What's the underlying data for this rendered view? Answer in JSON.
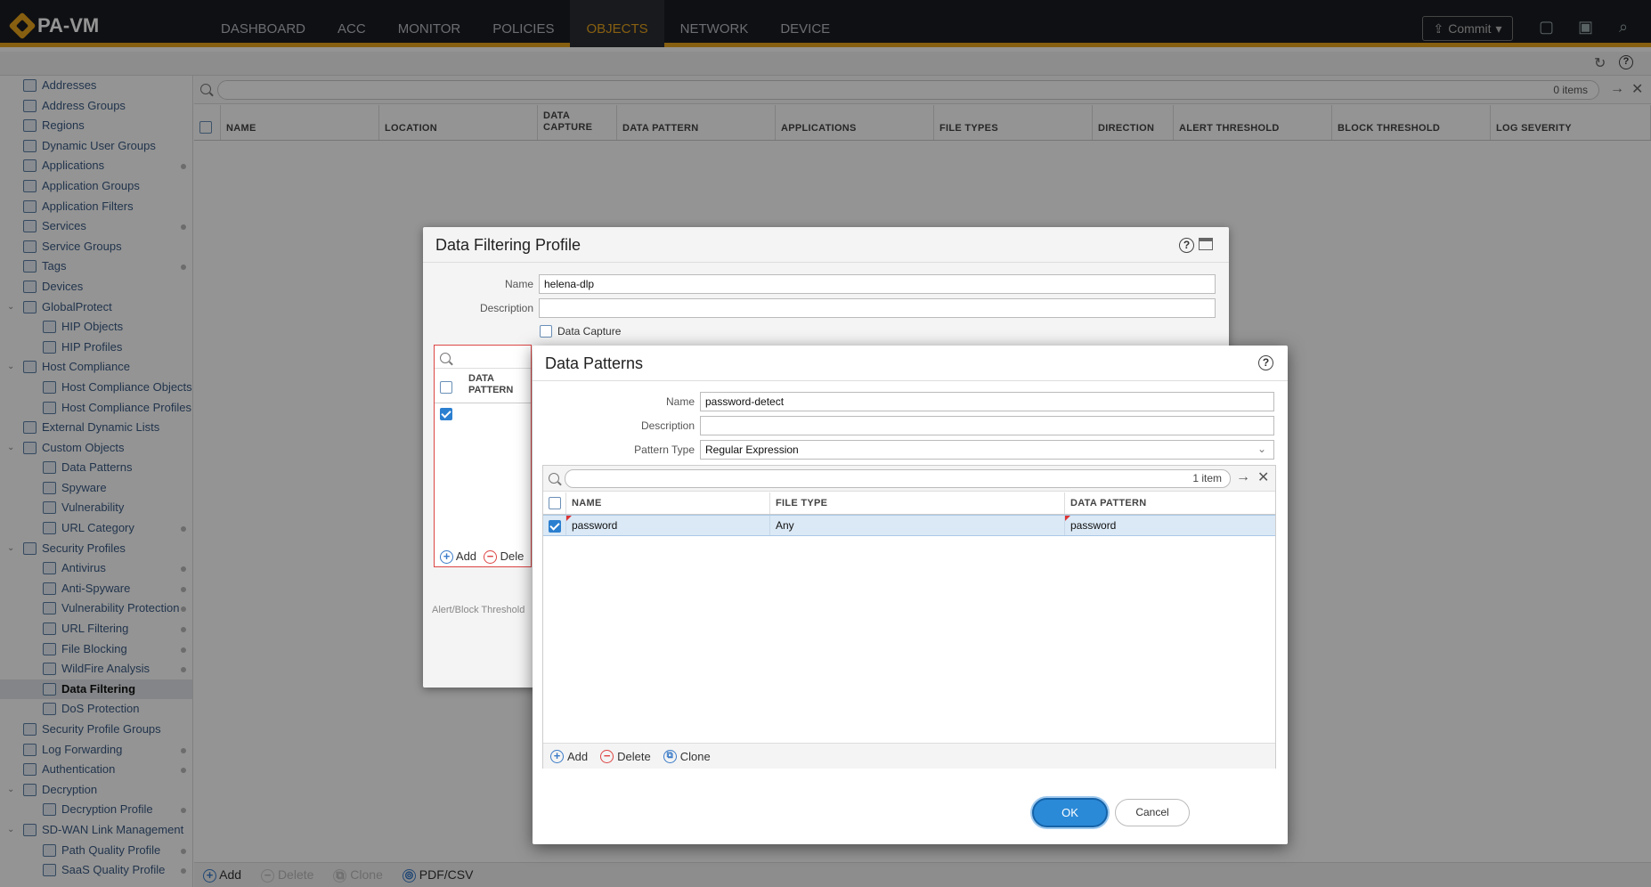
{
  "app": {
    "logo": "PA-VM"
  },
  "nav": [
    "DASHBOARD",
    "ACC",
    "MONITOR",
    "POLICIES",
    "OBJECTS",
    "NETWORK",
    "DEVICE"
  ],
  "nav_active": "OBJECTS",
  "commit_label": "Commit",
  "sidebar": [
    {
      "label": "Addresses",
      "indent": 1
    },
    {
      "label": "Address Groups",
      "indent": 1
    },
    {
      "label": "Regions",
      "indent": 1
    },
    {
      "label": "Dynamic User Groups",
      "indent": 1
    },
    {
      "label": "Applications",
      "indent": 1,
      "dot": true
    },
    {
      "label": "Application Groups",
      "indent": 1
    },
    {
      "label": "Application Filters",
      "indent": 1
    },
    {
      "label": "Services",
      "indent": 1,
      "dot": true
    },
    {
      "label": "Service Groups",
      "indent": 1
    },
    {
      "label": "Tags",
      "indent": 1,
      "dot": true
    },
    {
      "label": "Devices",
      "indent": 1
    },
    {
      "label": "GlobalProtect",
      "indent": 1,
      "twist": true
    },
    {
      "label": "HIP Objects",
      "indent": 2
    },
    {
      "label": "HIP Profiles",
      "indent": 2
    },
    {
      "label": "Host Compliance",
      "indent": 1,
      "twist": true
    },
    {
      "label": "Host Compliance Objects",
      "indent": 2
    },
    {
      "label": "Host Compliance Profiles",
      "indent": 2
    },
    {
      "label": "External Dynamic Lists",
      "indent": 1
    },
    {
      "label": "Custom Objects",
      "indent": 1,
      "twist": true
    },
    {
      "label": "Data Patterns",
      "indent": 2
    },
    {
      "label": "Spyware",
      "indent": 2
    },
    {
      "label": "Vulnerability",
      "indent": 2
    },
    {
      "label": "URL Category",
      "indent": 2,
      "dot": true
    },
    {
      "label": "Security Profiles",
      "indent": 1,
      "twist": true
    },
    {
      "label": "Antivirus",
      "indent": 2,
      "dot": true
    },
    {
      "label": "Anti-Spyware",
      "indent": 2,
      "dot": true
    },
    {
      "label": "Vulnerability Protection",
      "indent": 2,
      "dot": true
    },
    {
      "label": "URL Filtering",
      "indent": 2,
      "dot": true
    },
    {
      "label": "File Blocking",
      "indent": 2,
      "dot": true
    },
    {
      "label": "WildFire Analysis",
      "indent": 2,
      "dot": true
    },
    {
      "label": "Data Filtering",
      "indent": 2,
      "selected": true
    },
    {
      "label": "DoS Protection",
      "indent": 2
    },
    {
      "label": "Security Profile Groups",
      "indent": 1
    },
    {
      "label": "Log Forwarding",
      "indent": 1,
      "dot": true
    },
    {
      "label": "Authentication",
      "indent": 1,
      "dot": true
    },
    {
      "label": "Decryption",
      "indent": 1,
      "twist": true
    },
    {
      "label": "Decryption Profile",
      "indent": 2,
      "dot": true
    },
    {
      "label": "SD-WAN Link Management",
      "indent": 1,
      "twist": true
    },
    {
      "label": "Path Quality Profile",
      "indent": 2,
      "dot": true
    },
    {
      "label": "SaaS Quality Profile",
      "indent": 2,
      "dot": true
    }
  ],
  "main": {
    "count": "0 items",
    "columns": [
      "NAME",
      "LOCATION",
      "DATA CAPTURE",
      "DATA PATTERN",
      "APPLICATIONS",
      "FILE TYPES",
      "DIRECTION",
      "ALERT THRESHOLD",
      "BLOCK THRESHOLD",
      "LOG SEVERITY"
    ]
  },
  "bottombar": {
    "add": "Add",
    "delete": "Delete",
    "clone": "Clone",
    "pdf": "PDF/CSV"
  },
  "dfp": {
    "title": "Data Filtering Profile",
    "name_label": "Name",
    "name_value": "helena-dlp",
    "desc_label": "Description",
    "desc_value": "",
    "capture_label": "Data Capture",
    "inner_col": "DATA PATTERN",
    "add": "Add",
    "delete_partial": "Dele",
    "threshold_note": "Alert/Block Threshold"
  },
  "dp": {
    "title": "Data Patterns",
    "name_label": "Name",
    "name_value": "password-detect",
    "desc_label": "Description",
    "desc_value": "",
    "type_label": "Pattern Type",
    "type_value": "Regular Expression",
    "count": "1 item",
    "columns": [
      "NAME",
      "FILE TYPE",
      "DATA PATTERN"
    ],
    "rows": [
      {
        "name": "password",
        "file_type": "Any",
        "pattern": "password"
      }
    ],
    "add": "Add",
    "delete": "Delete",
    "clone": "Clone",
    "ok": "OK",
    "cancel": "Cancel"
  }
}
